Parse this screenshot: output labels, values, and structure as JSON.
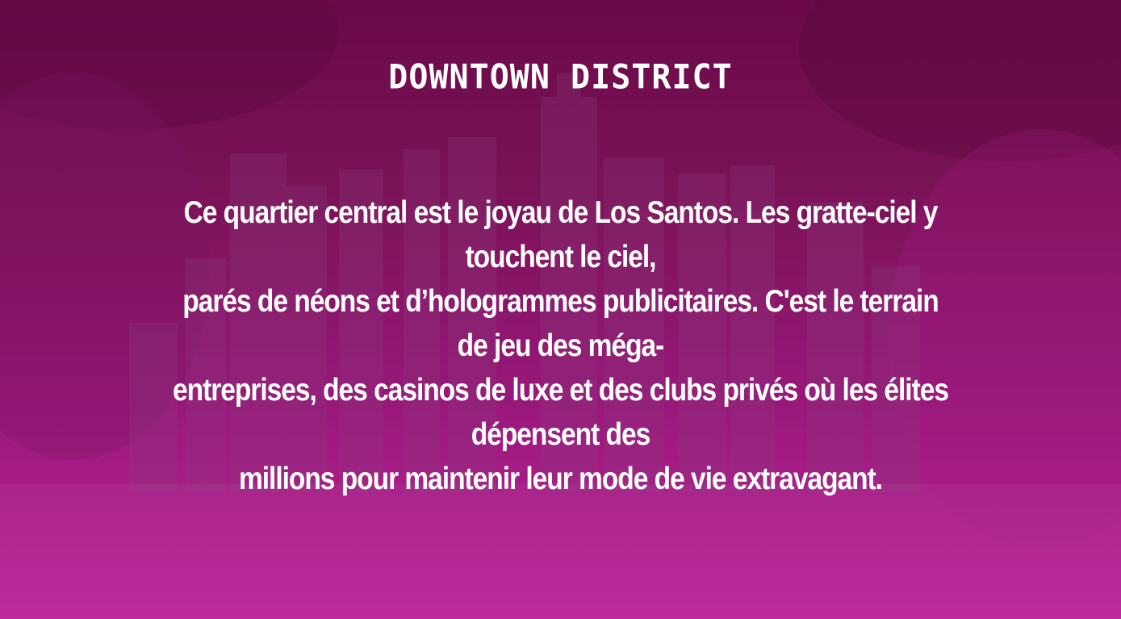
{
  "page": {
    "title": "DOWNTOWN DISTRICT",
    "description_lines": [
      "Ce quartier central est le joyau de Los Santos. Les gratte-ciel y",
      "touchent le ciel,",
      "parés de néons et d’hologrammes publicitaires. C'est le terrain",
      "de jeu des méga-",
      "entreprises, des casinos de luxe et des clubs privés où les élites",
      "dépensent des",
      "millions pour maintenir leur mode de vie extravagant."
    ]
  },
  "colors": {
    "background_top": "#6a0a48",
    "background_bottom": "#c0249c",
    "text": "#ffffff"
  }
}
